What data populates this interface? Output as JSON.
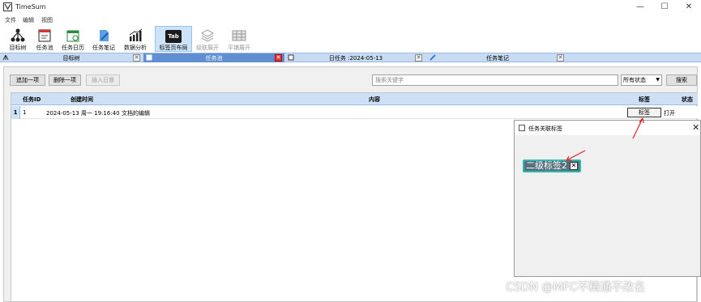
{
  "window": {
    "title": "TimeSum",
    "controls": {
      "minimize": "—",
      "maximize": "☐",
      "close": "✕"
    }
  },
  "menu": [
    "文件",
    "编辑",
    "视图"
  ],
  "toolbar": {
    "items": [
      {
        "label": "目标树",
        "icon": "tree-icon"
      },
      {
        "label": "任务池",
        "icon": "task-pool-icon"
      },
      {
        "label": "任务日历",
        "icon": "calendar-icon"
      },
      {
        "label": "任务笔记",
        "icon": "note-icon"
      },
      {
        "label": "数据分析",
        "icon": "chart-icon"
      },
      {
        "label": "标签页布局",
        "icon": "tab-layout-icon",
        "badge": "Tab",
        "active": true
      },
      {
        "label": "级联展开",
        "icon": "cascade-icon",
        "disabled": true
      },
      {
        "label": "平铺展开",
        "icon": "tile-icon",
        "disabled": true
      }
    ]
  },
  "tabs": [
    {
      "label": "目标树",
      "active": false
    },
    {
      "label": "任务池",
      "active": true
    },
    {
      "label": "日任务 :2024-05-13",
      "active": false
    },
    {
      "label": "任务笔记",
      "active": false
    }
  ],
  "actions": {
    "add": "追加一项",
    "delete": "删除一项",
    "insert_log": "插入日督",
    "search_placeholder": "搜索关键字",
    "status_selected": "所有状态",
    "search": "搜索"
  },
  "table": {
    "columns": [
      "任务ID",
      "创建时间",
      "内容",
      "标签",
      "状态"
    ],
    "rows": [
      {
        "row_number": "1",
        "id": "1",
        "created": "2024-05-13 周一 19:16:40",
        "content": "文档的编辑",
        "tag_button": "标签",
        "status": "打开"
      }
    ]
  },
  "dialog": {
    "title": "任务关联标签",
    "close": "✕",
    "tags": [
      {
        "label": "二级标签2",
        "remove": "✕"
      }
    ]
  },
  "watermark": "CSDN @MFC不精通不改名",
  "colors": {
    "active_tab": "#5f8fd0",
    "header": "#cde0f5",
    "tag_chip_border": "#2bb8b0",
    "annotation_arrow": "#e02020"
  }
}
